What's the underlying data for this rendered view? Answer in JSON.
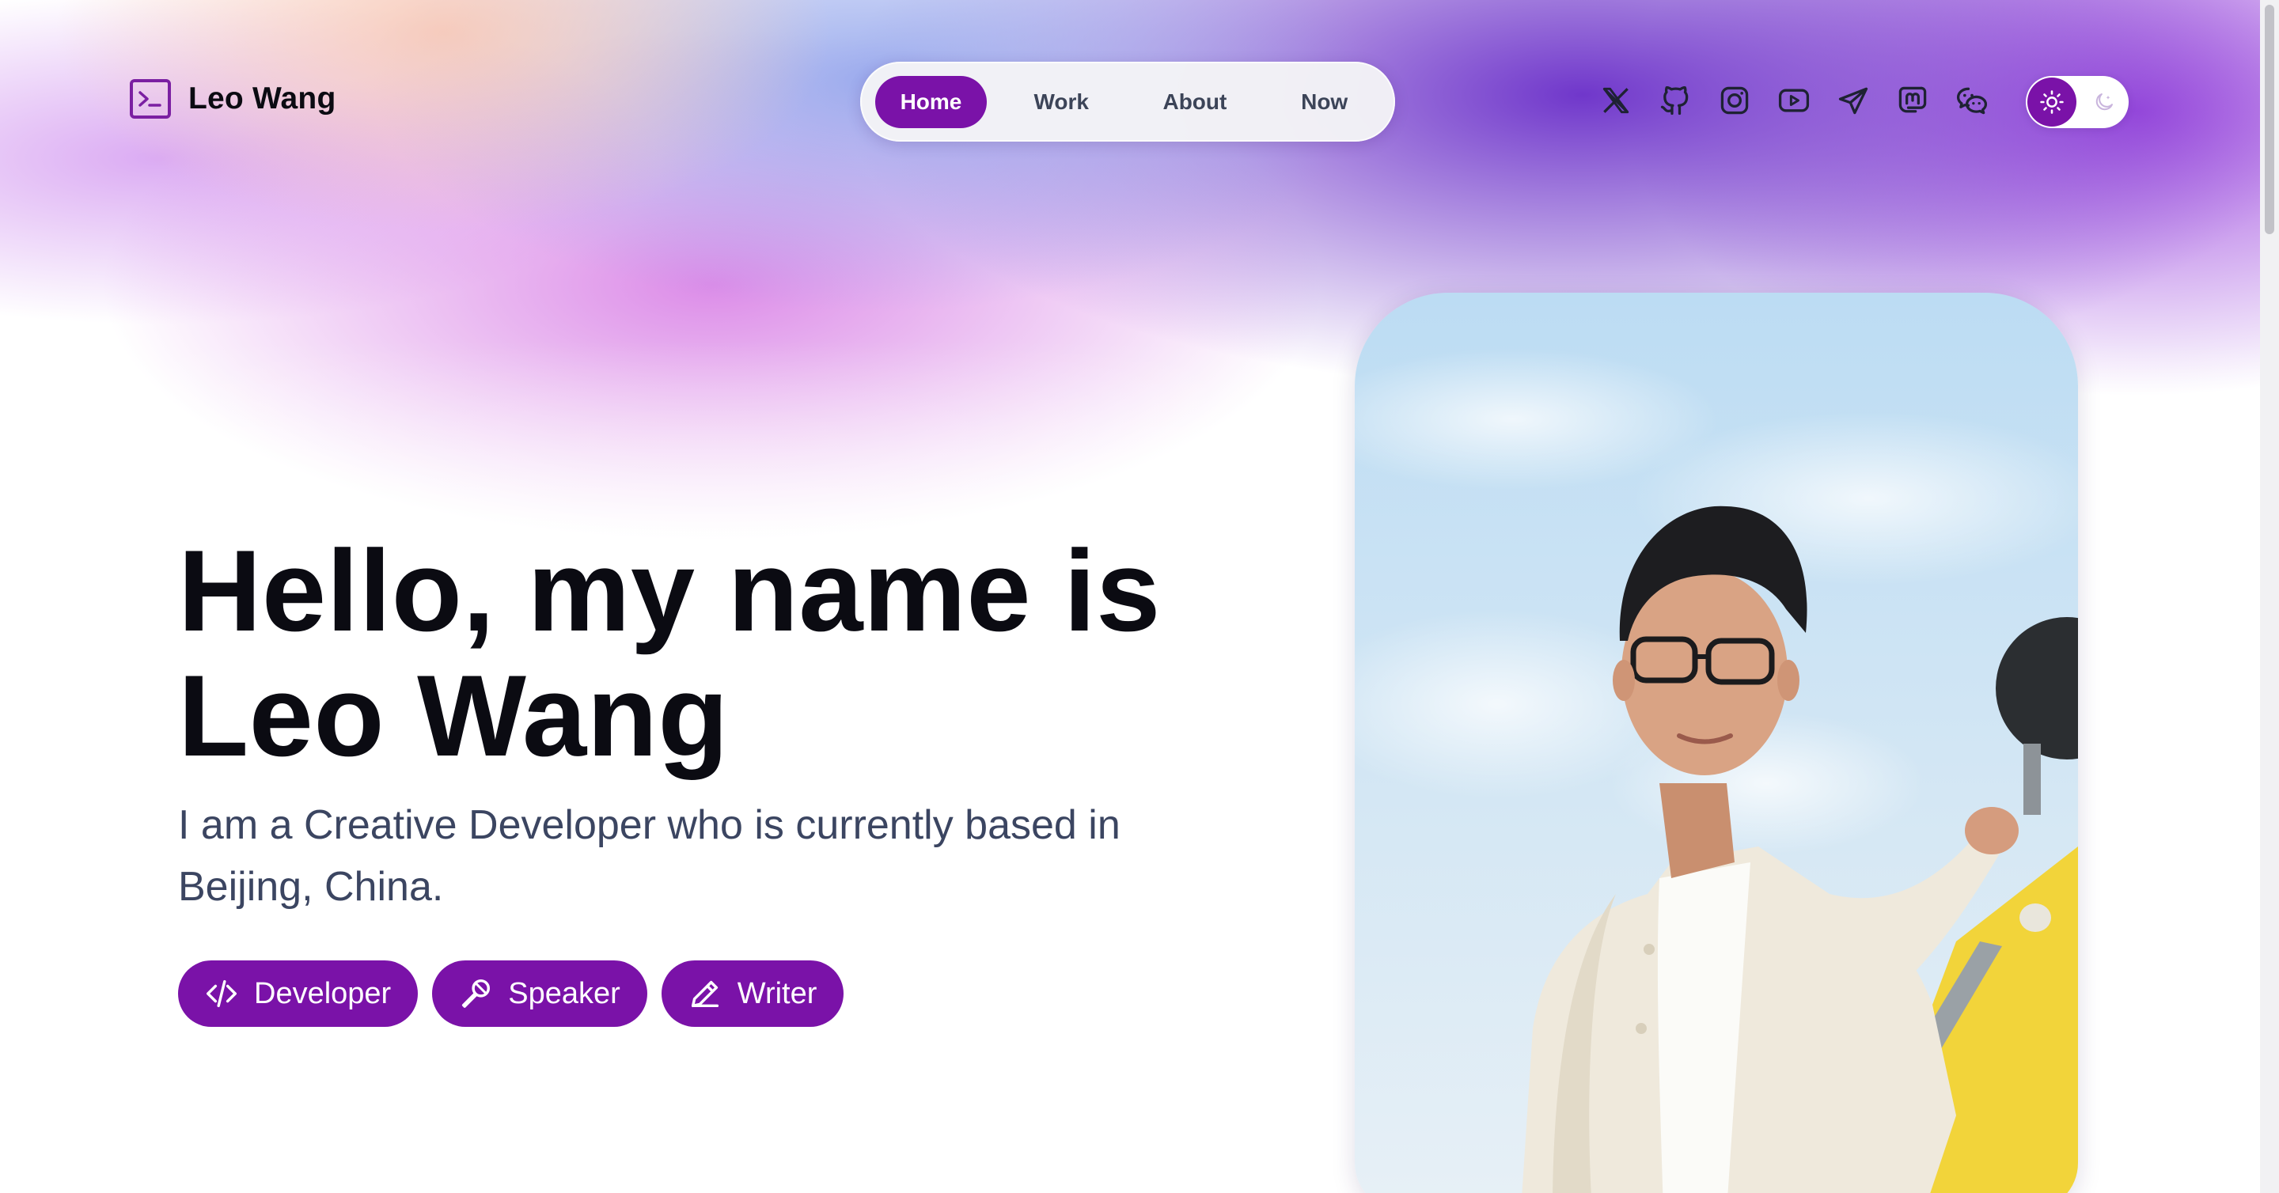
{
  "brand": {
    "name": "Leo Wang",
    "logo_icon": "terminal-icon",
    "accent": "#7a12a8"
  },
  "nav": {
    "tabs": [
      {
        "label": "Home",
        "active": true
      },
      {
        "label": "Work",
        "active": false
      },
      {
        "label": "About",
        "active": false
      },
      {
        "label": "Now",
        "active": false
      }
    ]
  },
  "socials": [
    "x-icon",
    "github-icon",
    "instagram-icon",
    "youtube-icon",
    "telegram-icon",
    "mastodon-icon",
    "wechat-icon"
  ],
  "theme": {
    "light_icon": "sun-icon",
    "dark_icon": "moon-icon",
    "mode": "light"
  },
  "hero": {
    "headline_line1": "Hello, my name is",
    "headline_line2": "Leo Wang",
    "intro": "I am a Creative Developer who is currently based in Beijing, China.",
    "roles": [
      {
        "label": "Developer",
        "icon": "code-icon"
      },
      {
        "label": "Speaker",
        "icon": "microphone-icon"
      },
      {
        "label": "Writer",
        "icon": "pencil-icon"
      }
    ]
  },
  "photo": {
    "subject": "portrait"
  }
}
